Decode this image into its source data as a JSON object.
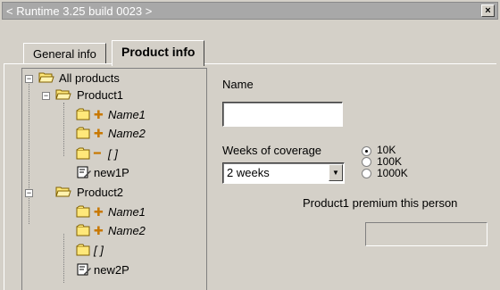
{
  "window": {
    "title": "< Runtime 3.25 build 0023 >",
    "close_glyph": "×"
  },
  "tabs": [
    {
      "label": "General info",
      "active": false
    },
    {
      "label": "Product info",
      "active": true
    }
  ],
  "tree": {
    "root": "All products",
    "product1": {
      "label": "Product1",
      "children": [
        "Name1",
        "Name2",
        "[ ]",
        "new1P"
      ]
    },
    "product2": {
      "label": "Product2",
      "children": [
        "Name1",
        "Name2",
        "[ ]",
        "new2P"
      ]
    },
    "expander_minus": "−",
    "plus_glyph": "✚",
    "minus_glyph": "━"
  },
  "form": {
    "name_label": "Name",
    "name_value": "",
    "weeks_label": "Weeks of coverage",
    "weeks_selected": "2 weeks",
    "radio_options": [
      {
        "label": "10K",
        "checked": true
      },
      {
        "label": "100K",
        "checked": false
      },
      {
        "label": "1000K",
        "checked": false
      }
    ],
    "premium_label": "Product1 premium this person",
    "premium_value": ""
  },
  "colors": {
    "titlebar": "#a8a8a8",
    "window_bg": "#d4d0c8",
    "folder_yellow": "#ffe87a",
    "plus_orange": "#c87800"
  }
}
